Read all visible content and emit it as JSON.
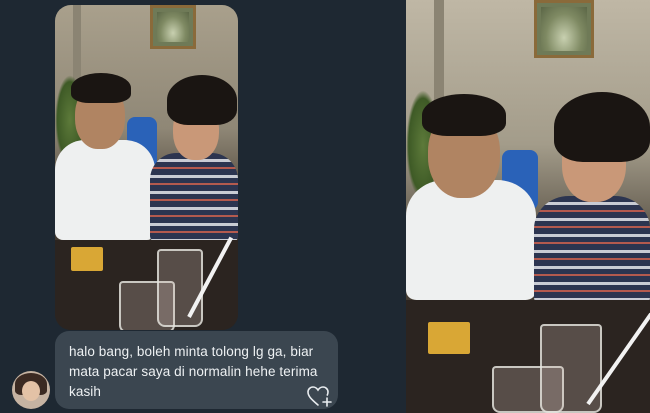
{
  "message": {
    "text": "halo bang, boleh minta tolong lg ga, biar mata pacar saya di normalin hehe terima kasih"
  },
  "icons": {
    "like": "heart-plus-icon",
    "avatar": "user-avatar"
  },
  "colors": {
    "background": "#1e2832",
    "bubble": "#3b4650",
    "text": "#eef1f3"
  }
}
